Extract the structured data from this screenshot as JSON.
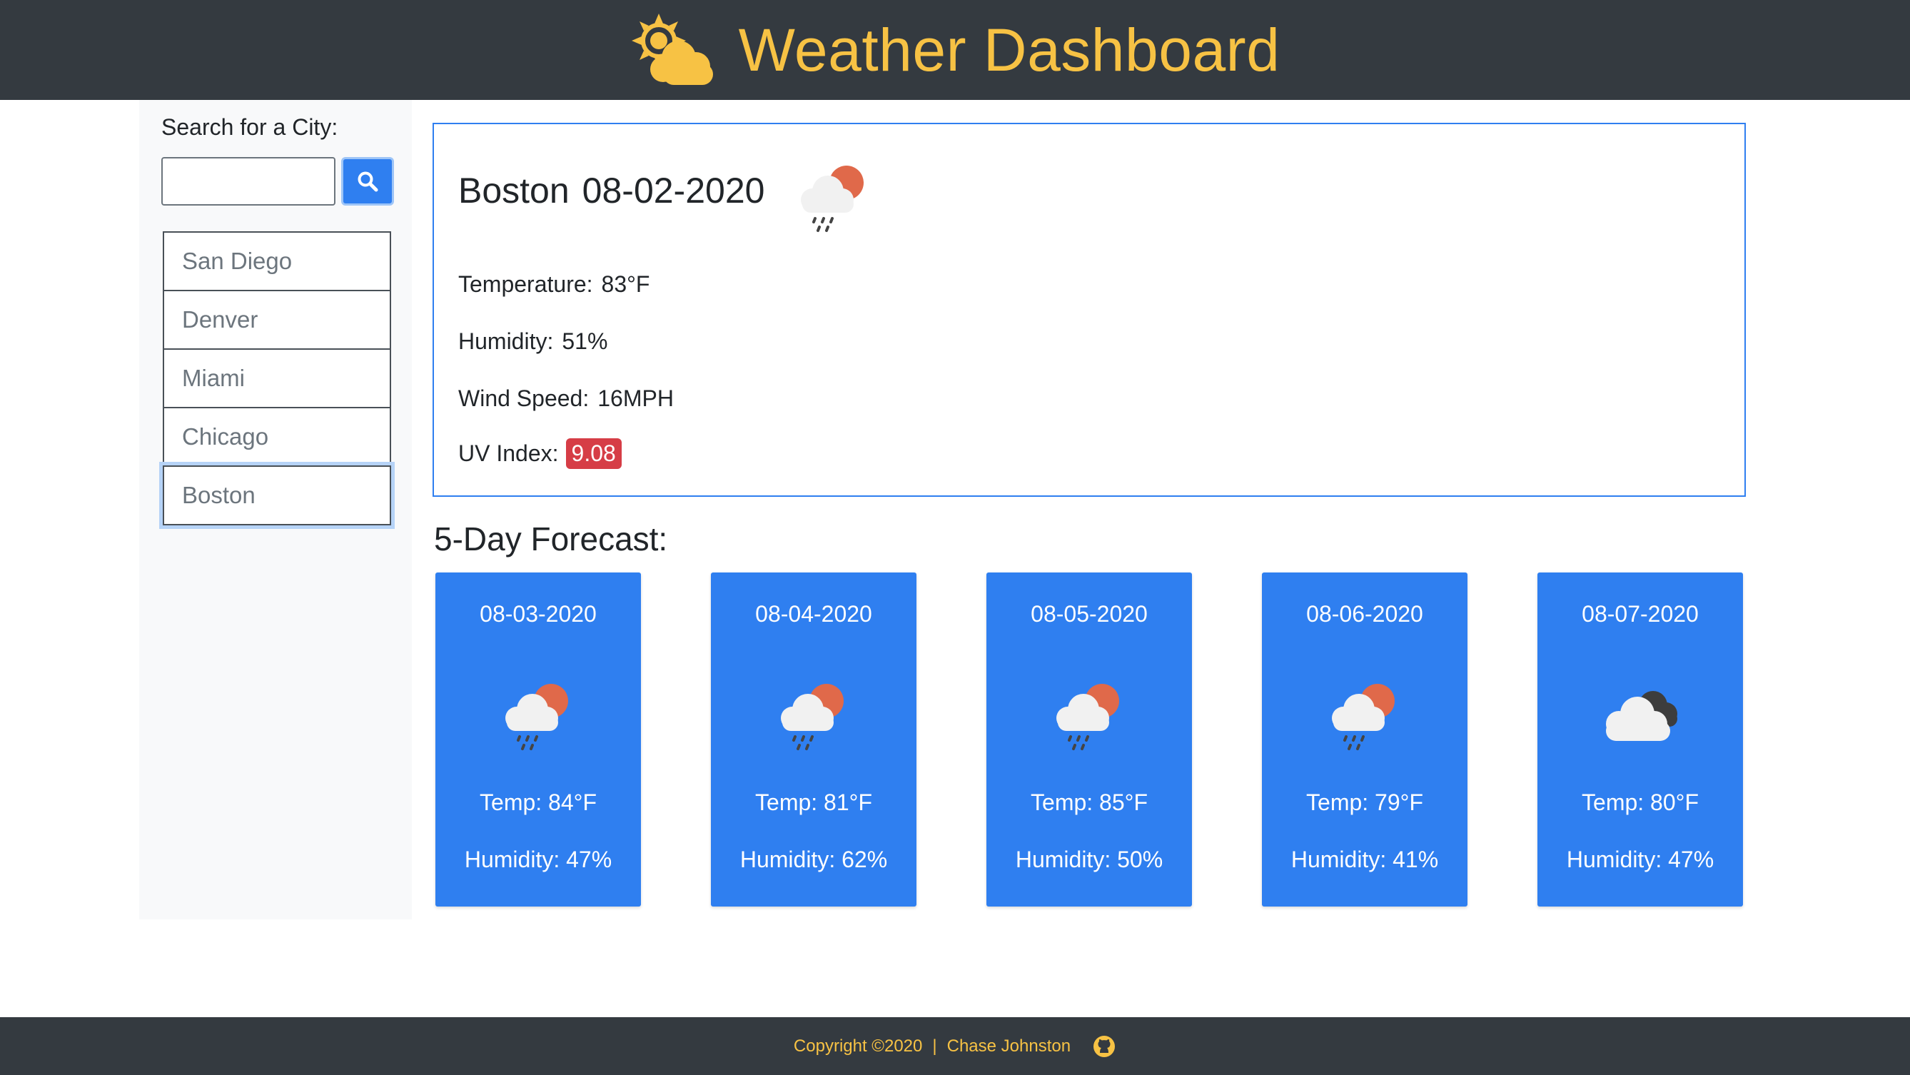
{
  "header": {
    "title": "Weather Dashboard",
    "logo_icon": "sun-cloud-icon"
  },
  "sidebar": {
    "search_label": "Search for a City:",
    "search_value": "",
    "search_icon": "search-icon",
    "cities": [
      "San Diego",
      "Denver",
      "Miami",
      "Chicago",
      "Boston"
    ],
    "selected_city": "Boston"
  },
  "current": {
    "city": "Boston",
    "date": "08-02-2020",
    "icon": "rain-cloud-sun-icon",
    "temperature_label": "Temperature:",
    "temperature": "83°F",
    "humidity_label": "Humidity:",
    "humidity": "51%",
    "wind_label": "Wind Speed:",
    "wind": "16MPH",
    "uv_label": "UV Index:",
    "uv": "9.08",
    "uv_color": "#d63d46"
  },
  "forecast": {
    "title": "5-Day Forecast:",
    "days": [
      {
        "date": "08-03-2020",
        "icon": "rain-cloud-sun-icon",
        "temp": "Temp: 84°F",
        "humidity": "Humidity: 47%"
      },
      {
        "date": "08-04-2020",
        "icon": "rain-cloud-sun-icon",
        "temp": "Temp: 81°F",
        "humidity": "Humidity: 62%"
      },
      {
        "date": "08-05-2020",
        "icon": "rain-cloud-sun-icon",
        "temp": "Temp: 85°F",
        "humidity": "Humidity: 50%"
      },
      {
        "date": "08-06-2020",
        "icon": "rain-cloud-sun-icon",
        "temp": "Temp: 79°F",
        "humidity": "Humidity: 41%"
      },
      {
        "date": "08-07-2020",
        "icon": "cloudy-icon",
        "temp": "Temp: 80°F",
        "humidity": "Humidity: 47%"
      }
    ]
  },
  "footer": {
    "copyright": "Copyright ©2020",
    "separator": "|",
    "author": "Chase Johnston",
    "github_icon": "github-icon"
  },
  "colors": {
    "header_bg": "#343a40",
    "accent_yellow": "#f7c244",
    "primary_blue": "#2f7ff0",
    "uv_red": "#d63d46"
  }
}
